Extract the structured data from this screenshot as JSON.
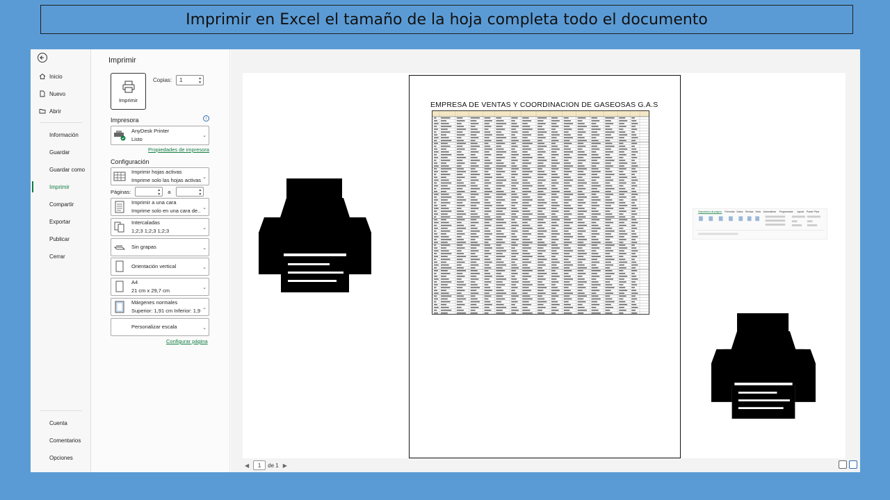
{
  "banner": {
    "title": "Imprimir en Excel el tamaño de la hoja completa todo el documento"
  },
  "nav": {
    "items": [
      {
        "label": "Inicio",
        "icon": "home-icon"
      },
      {
        "label": "Nuevo",
        "icon": "new-document-icon"
      },
      {
        "label": "Abrir",
        "icon": "folder-open-icon"
      },
      {
        "label": "Información"
      },
      {
        "label": "Guardar"
      },
      {
        "label": "Guardar como"
      },
      {
        "label": "Imprimir",
        "active": true
      },
      {
        "label": "Compartir"
      },
      {
        "label": "Exportar"
      },
      {
        "label": "Publicar"
      },
      {
        "label": "Cerrar"
      }
    ],
    "footer": [
      {
        "label": "Cuenta"
      },
      {
        "label": "Comentarios"
      },
      {
        "label": "Opciones"
      }
    ],
    "accent": "#107c41"
  },
  "print": {
    "title": "Imprimir",
    "button_label": "Imprimir",
    "copies_label": "Copias:",
    "copies_value": "1",
    "printer_section": "Impresora",
    "printer_name": "AnyDesk Printer",
    "printer_status": "Listo",
    "printer_properties": "Propiedades de impresora",
    "config_section": "Configuración",
    "settings": [
      {
        "line1": "Imprimir hojas activas",
        "line2": "Imprime solo las hojas activas"
      },
      {
        "line1": "Imprimir a una cara",
        "line2": "Imprime solo en una cara de..."
      },
      {
        "line1": "Intercaladas",
        "line2": "1;2;3    1;2;3    1;2;3"
      },
      {
        "line1": "Sin grapas",
        "line2": ""
      },
      {
        "line1": "Orientación vertical",
        "line2": ""
      },
      {
        "line1": "A4",
        "line2": "21 cm x 29,7 cm"
      },
      {
        "line1": "Márgenes normales",
        "line2": "Superior: 1,91 cm Inferior: 1,9..."
      },
      {
        "line1": "Personalizar escala",
        "line2": ""
      }
    ],
    "pages_label": "Páginas:",
    "pages_to": "a",
    "page_setup_link": "Configurar página"
  },
  "preview": {
    "sheet_title": "EMPRESA DE VENTAS Y COORDINACION DE GASEOSAS G.A.S",
    "current_page": "1",
    "of_label": "de 1"
  }
}
